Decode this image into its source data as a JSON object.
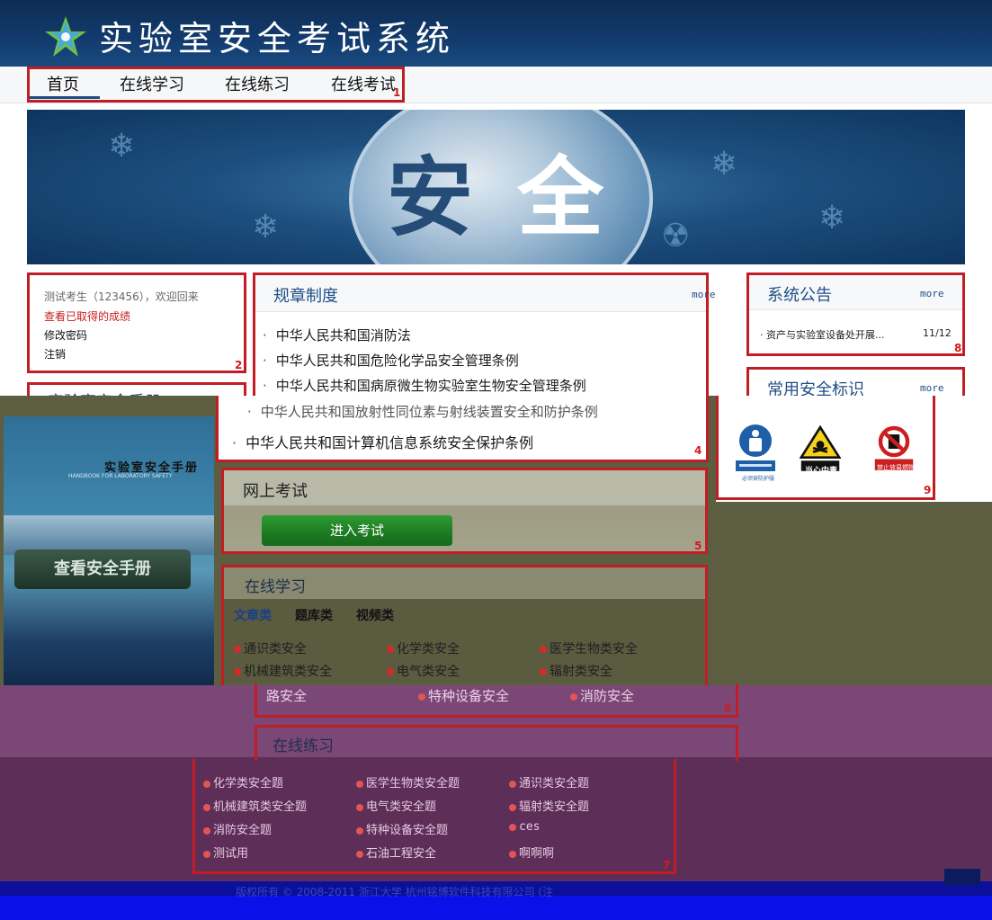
{
  "app": {
    "title": "实验室安全考试系统"
  },
  "nav": {
    "items": [
      "首页",
      "在线学习",
      "在线练习",
      "在线考试"
    ],
    "active_index": 0
  },
  "annotations": [
    "1",
    "2",
    "4",
    "5",
    "6",
    "7",
    "8",
    "9"
  ],
  "banner": {
    "char1": "安",
    "char2": "全"
  },
  "user": {
    "greeting": "测试考生（123456），欢迎回来",
    "grades_link": "查看已取得的成绩",
    "change_password": "修改密码",
    "logout": "注销"
  },
  "rules": {
    "title": "规章制度",
    "more": "more",
    "items": [
      "中华人民共和国消防法",
      "中华人民共和国危险化学品安全管理条例",
      "中华人民共和国病原微生物实验室生物安全管理条例",
      "中华人民共和国放射性同位素与射线装置安全和防护条例",
      "中华人民共和国计算机信息系统安全保护条例"
    ]
  },
  "announcements": {
    "title": "系统公告",
    "more": "more",
    "items": [
      {
        "text": "资产与实验室设备处开展...",
        "date": "11/12"
      }
    ]
  },
  "safety_signs": {
    "title": "常用安全标识",
    "more": "more",
    "signs": [
      "必须穿防护服",
      "当心中毒",
      "禁止放易燃物"
    ]
  },
  "handbook": {
    "title": "实验室安全手册",
    "cover_title": "实验室安全手册",
    "cover_subtitle": "HANDBOOK FOR LABORATORY SAFETY",
    "button": "查看安全手册"
  },
  "online_exam": {
    "title": "网上考试",
    "button": "进入考试"
  },
  "online_study": {
    "title": "在线学习",
    "tabs": [
      "文章类",
      "题库类",
      "视频类"
    ],
    "categories": [
      "通识类安全",
      "化学类安全",
      "医学生物类安全",
      "机械建筑类安全",
      "电气类安全",
      "辐射类安全",
      "特种设备安全",
      "消防安全"
    ],
    "partial_category": "路安全"
  },
  "online_practice": {
    "title": "在线练习",
    "categories": [
      "化学类安全题",
      "医学生物类安全题",
      "通识类安全题",
      "机械建筑类安全题",
      "电气类安全题",
      "辐射类安全题",
      "消防安全题",
      "特种设备安全题",
      "ces",
      "测试用",
      "石油工程安全",
      "啊啊啊"
    ]
  },
  "footer": {
    "copyright": "版权所有 © 2008-2011   浙江大学   杭州铭博软件科技有限公司 (注"
  },
  "colors": {
    "header": "#123a6b",
    "accent": "#1f4f86",
    "annotation": "#c21d24",
    "button": "#1d7a22"
  }
}
